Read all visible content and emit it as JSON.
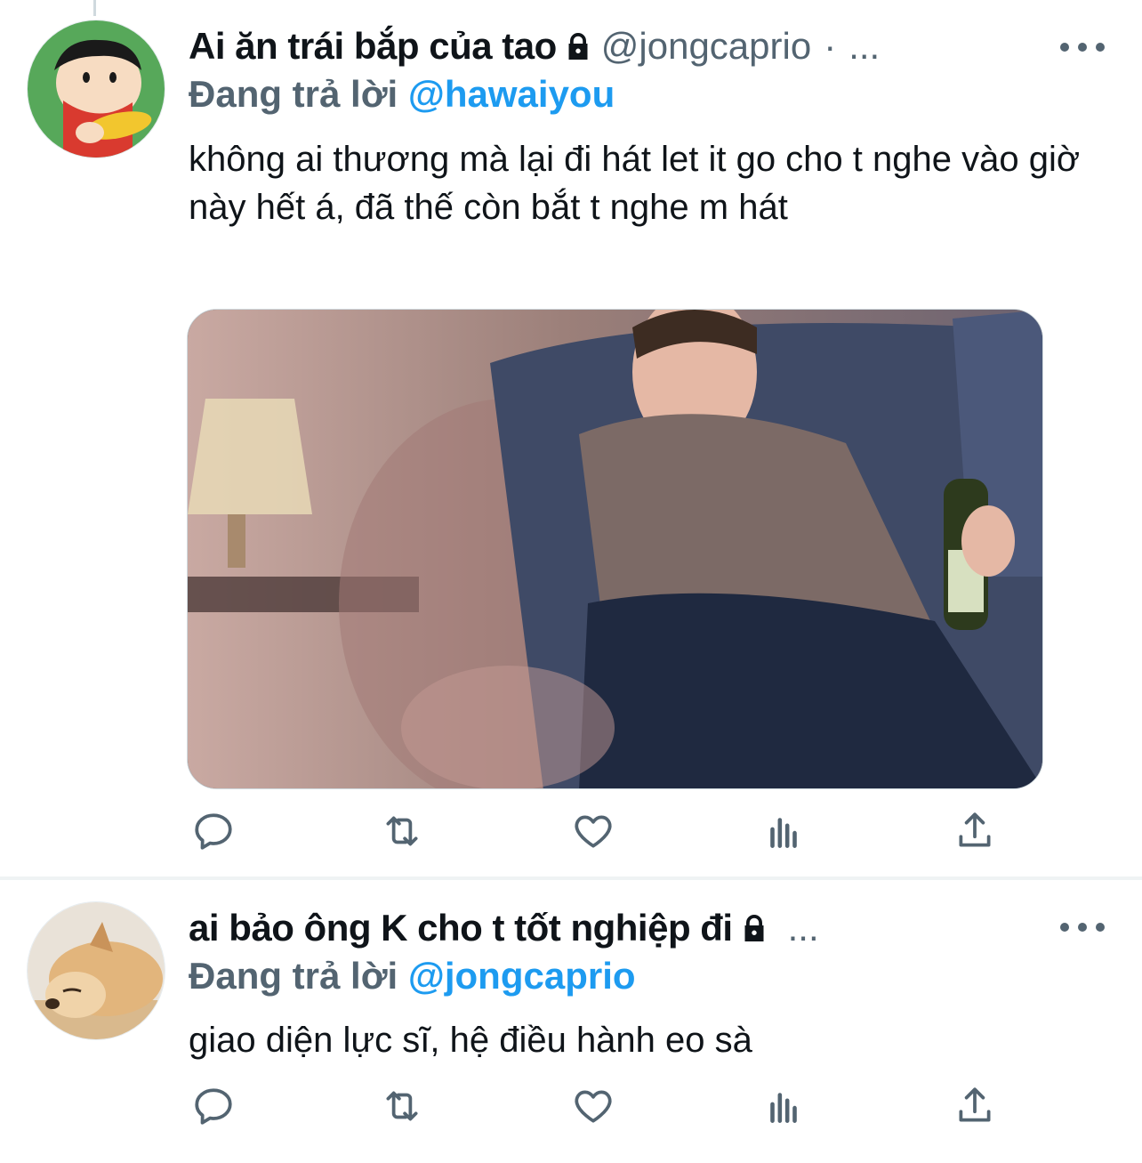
{
  "tweets": [
    {
      "display_name": "Ai ăn trái bắp của tao",
      "handle": "@jongcaprio",
      "separator": "·",
      "overflow": "...",
      "replying_label": "Đang trả lời",
      "replying_to": "@hawaiyou",
      "text": "không ai thương mà lại đi hát let it go cho t nghe vào giờ này hết á, đã thế còn bắt t nghe m hát",
      "has_media": true
    },
    {
      "display_name": "ai bảo ông K cho t tốt nghiệp đi",
      "handle": "",
      "overflow": "...",
      "replying_label": "Đang trả lời",
      "replying_to": "@jongcaprio",
      "text": "giao diện lực sĩ, hệ điều hành eo sà",
      "has_media": false
    }
  ],
  "action_icons": [
    "reply-icon",
    "retweet-icon",
    "like-icon",
    "analytics-icon",
    "share-icon"
  ],
  "colors": {
    "text_primary": "#0f1419",
    "text_secondary": "#536471",
    "link": "#1d9bf0",
    "divider": "#eff3f4"
  }
}
